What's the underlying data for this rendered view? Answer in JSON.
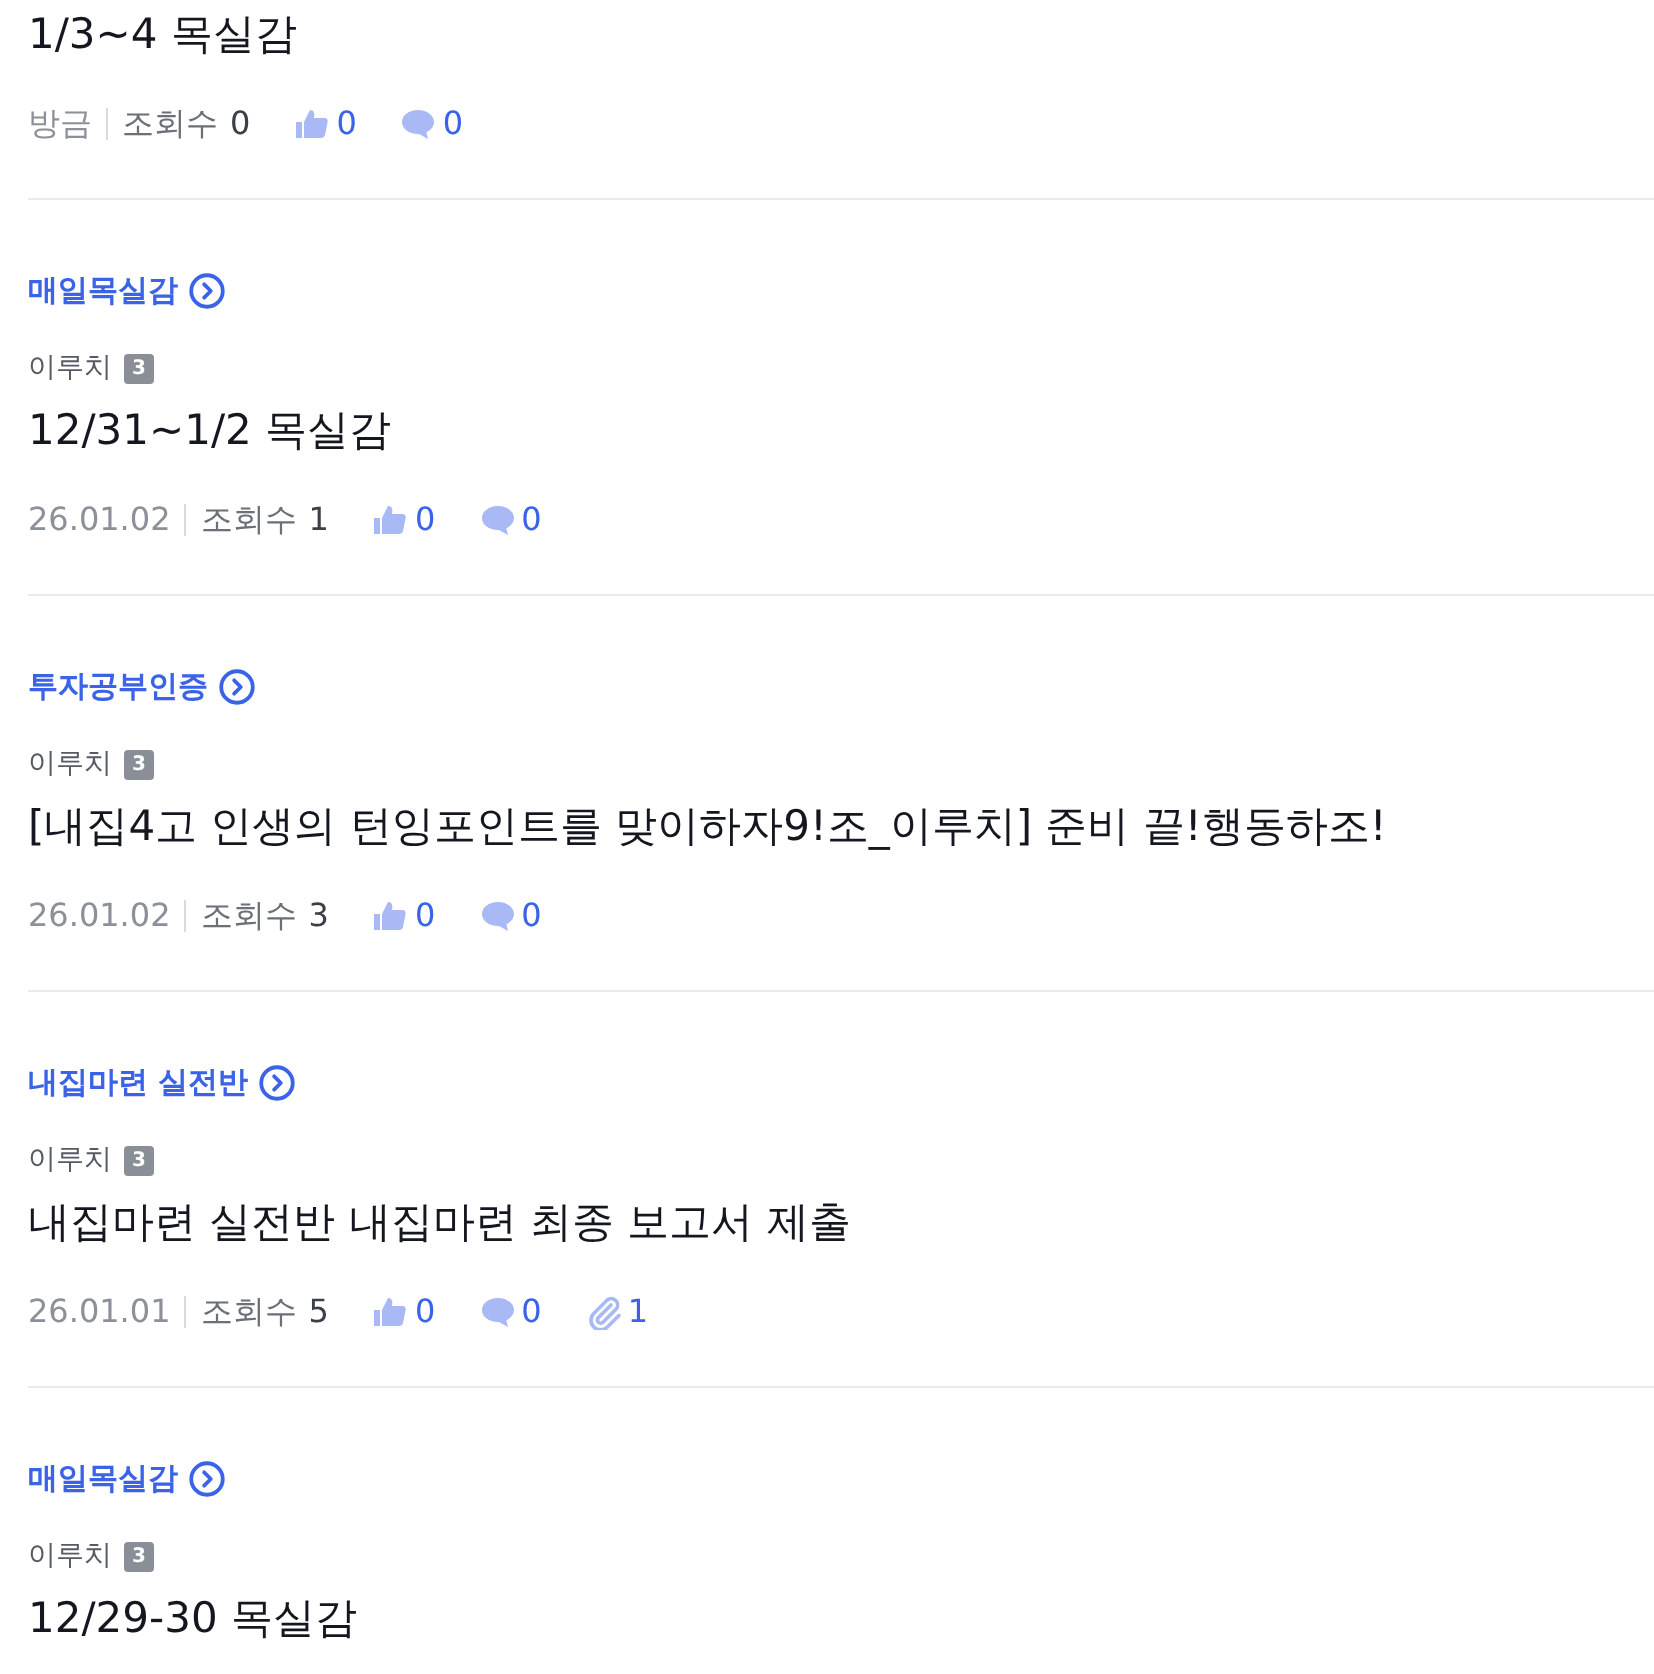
{
  "posts": [
    {
      "title": "1/3~4 목실감",
      "date": "방금",
      "views_label": "조회수",
      "views": "0",
      "likes": "0",
      "comments": "0"
    },
    {
      "board": "매일목실감",
      "author": "이루치",
      "level": "3",
      "title": "12/31~1/2 목실감",
      "date": "26.01.02",
      "views_label": "조회수",
      "views": "1",
      "likes": "0",
      "comments": "0"
    },
    {
      "board": "투자공부인증",
      "author": "이루치",
      "level": "3",
      "title": "[내집4고 인생의 턴잉포인트를 맞이하자9!조_이루치] 준비 끝!행동하조!",
      "date": "26.01.02",
      "views_label": "조회수",
      "views": "3",
      "likes": "0",
      "comments": "0"
    },
    {
      "board": "내집마련 실전반",
      "author": "이루치",
      "level": "3",
      "title": "내집마련 실전반 내집마련 최종 보고서 제출",
      "date": "26.01.01",
      "views_label": "조회수",
      "views": "5",
      "likes": "0",
      "comments": "0",
      "attachments": "1"
    },
    {
      "board": "매일목실감",
      "author": "이루치",
      "level": "3",
      "title": "12/29-30 목실감"
    }
  ]
}
